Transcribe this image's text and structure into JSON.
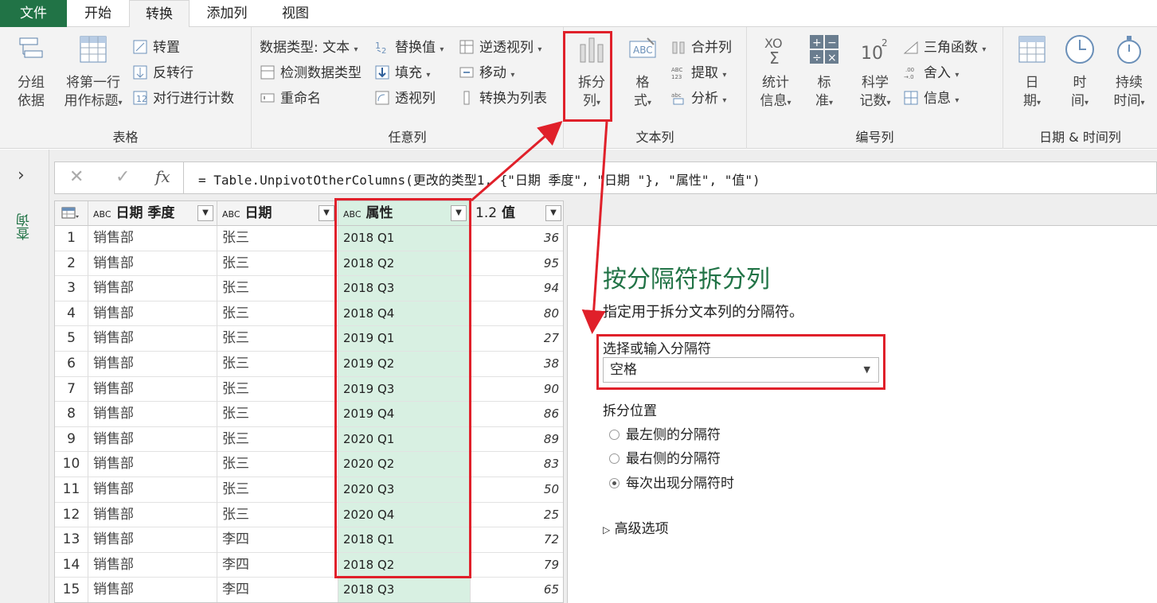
{
  "tabs": {
    "file": "文件",
    "home": "开始",
    "transform": "转换",
    "add_column": "添加列",
    "view": "视图"
  },
  "ribbon": {
    "table_group": {
      "label": "表格",
      "group_by": "分组\n依据",
      "use_first_row": "将第一行\n用作标题",
      "transpose": "转置",
      "reverse_rows": "反转行",
      "count_rows": "对行进行计数"
    },
    "any_column": {
      "label": "任意列",
      "data_type": "数据类型: 文本",
      "detect_type": "检测数据类型",
      "rename": "重命名",
      "replace": "替换值",
      "fill": "填充",
      "pivot": "透视列",
      "unpivot": "逆透视列",
      "move": "移动",
      "to_list": "转换为列表"
    },
    "text_column": {
      "label": "文本列",
      "split": "拆分\n列",
      "format": "格\n式",
      "merge": "合并列",
      "extract": "提取",
      "parse": "分析"
    },
    "number_column": {
      "label": "编号列",
      "statistics": "统计\n信息",
      "standard": "标\n准",
      "scientific": "科学\n记数",
      "trig": "三角函数",
      "rounding": "舍入",
      "information": "信息"
    },
    "datetime_column": {
      "label": "日期 & 时间列",
      "date": "日\n期",
      "time": "时\n间",
      "duration": "持续\n时间"
    }
  },
  "left_pane": {
    "queries": "查询"
  },
  "formula": {
    "text": "= Table.UnpivotOtherColumns(更改的类型1, {\"日期 季度\", \"日期 \"}, \"属性\", \"值\")",
    "fx": "fx"
  },
  "columns": [
    "日期 季度",
    "日期",
    "属性",
    "值"
  ],
  "column_types": [
    "ABC",
    "ABC",
    "ABC",
    "1.2"
  ],
  "rows": [
    [
      "1",
      "销售部",
      "张三",
      "2018 Q1",
      "36"
    ],
    [
      "2",
      "销售部",
      "张三",
      "2018 Q2",
      "95"
    ],
    [
      "3",
      "销售部",
      "张三",
      "2018 Q3",
      "94"
    ],
    [
      "4",
      "销售部",
      "张三",
      "2018 Q4",
      "80"
    ],
    [
      "5",
      "销售部",
      "张三",
      "2019 Q1",
      "27"
    ],
    [
      "6",
      "销售部",
      "张三",
      "2019 Q2",
      "38"
    ],
    [
      "7",
      "销售部",
      "张三",
      "2019 Q3",
      "90"
    ],
    [
      "8",
      "销售部",
      "张三",
      "2019 Q4",
      "86"
    ],
    [
      "9",
      "销售部",
      "张三",
      "2020 Q1",
      "89"
    ],
    [
      "10",
      "销售部",
      "张三",
      "2020 Q2",
      "83"
    ],
    [
      "11",
      "销售部",
      "张三",
      "2020 Q3",
      "50"
    ],
    [
      "12",
      "销售部",
      "张三",
      "2020 Q4",
      "25"
    ],
    [
      "13",
      "销售部",
      "李四",
      "2018 Q1",
      "72"
    ],
    [
      "14",
      "销售部",
      "李四",
      "2018 Q2",
      "79"
    ],
    [
      "15",
      "销售部",
      "李四",
      "2018 Q3",
      "65"
    ]
  ],
  "split_panel": {
    "title": "按分隔符拆分列",
    "description": "指定用于拆分文本列的分隔符。",
    "delimiter_label": "选择或输入分隔符",
    "delimiter_value": "空格",
    "position_label": "拆分位置",
    "options": [
      "最左侧的分隔符",
      "最右侧的分隔符",
      "每次出现分隔符时"
    ],
    "selected_option": 2,
    "advanced": "高级选项"
  },
  "colors": {
    "accent": "#217346",
    "highlight": "#e0202a",
    "selected_column": "#d8f0e2"
  }
}
